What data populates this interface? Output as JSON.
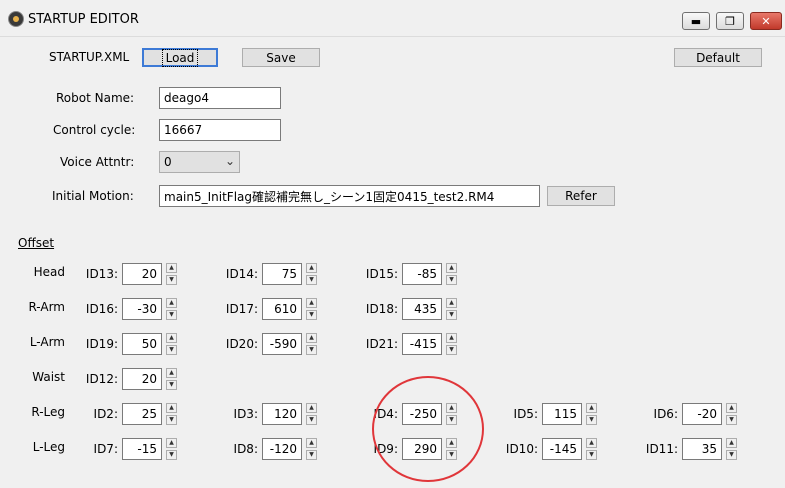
{
  "window": {
    "title": "STARTUP EDITOR",
    "minimize": "▬",
    "maximize": "❐",
    "close": "✕"
  },
  "file": {
    "label": "STARTUP.XML",
    "load": "Load",
    "save": "Save",
    "default": "Default"
  },
  "form": {
    "robot_name_label": "Robot Name:",
    "robot_name_value": "deago4",
    "control_cycle_label": "Control cycle:",
    "control_cycle_value": "16667",
    "voice_label": "Voice Attntr:",
    "voice_value": "0",
    "motion_label": "Initial Motion:",
    "motion_value": "main5_InitFlag確認補完無し_シーン1固定0415_test2.RM4",
    "refer": "Refer"
  },
  "offset": {
    "title": "Offset",
    "rows": [
      {
        "label": "Head",
        "fields": [
          {
            "id": "ID13:",
            "value": "20"
          },
          {
            "id": "ID14:",
            "value": "75"
          },
          {
            "id": "ID15:",
            "value": "-85"
          }
        ]
      },
      {
        "label": "R-Arm",
        "fields": [
          {
            "id": "ID16:",
            "value": "-30"
          },
          {
            "id": "ID17:",
            "value": "610"
          },
          {
            "id": "ID18:",
            "value": "435"
          }
        ]
      },
      {
        "label": "L-Arm",
        "fields": [
          {
            "id": "ID19:",
            "value": "50"
          },
          {
            "id": "ID20:",
            "value": "-590"
          },
          {
            "id": "ID21:",
            "value": "-415"
          }
        ]
      },
      {
        "label": "Waist",
        "fields": [
          {
            "id": "ID12:",
            "value": "20"
          }
        ]
      },
      {
        "label": "R-Leg",
        "fields": [
          {
            "id": "ID2:",
            "value": "25"
          },
          {
            "id": "ID3:",
            "value": "120"
          },
          {
            "id": "ID4:",
            "value": "-250"
          },
          {
            "id": "ID5:",
            "value": "115"
          },
          {
            "id": "ID6:",
            "value": "-20"
          }
        ]
      },
      {
        "label": "L-Leg",
        "fields": [
          {
            "id": "ID7:",
            "value": "-15"
          },
          {
            "id": "ID8:",
            "value": "-120"
          },
          {
            "id": "ID9:",
            "value": "290"
          },
          {
            "id": "ID10:",
            "value": "-145"
          },
          {
            "id": "ID11:",
            "value": "35"
          }
        ]
      }
    ]
  },
  "colors": {
    "annotation_circle": "#e0363a",
    "focus_border": "#3d7ad6"
  }
}
